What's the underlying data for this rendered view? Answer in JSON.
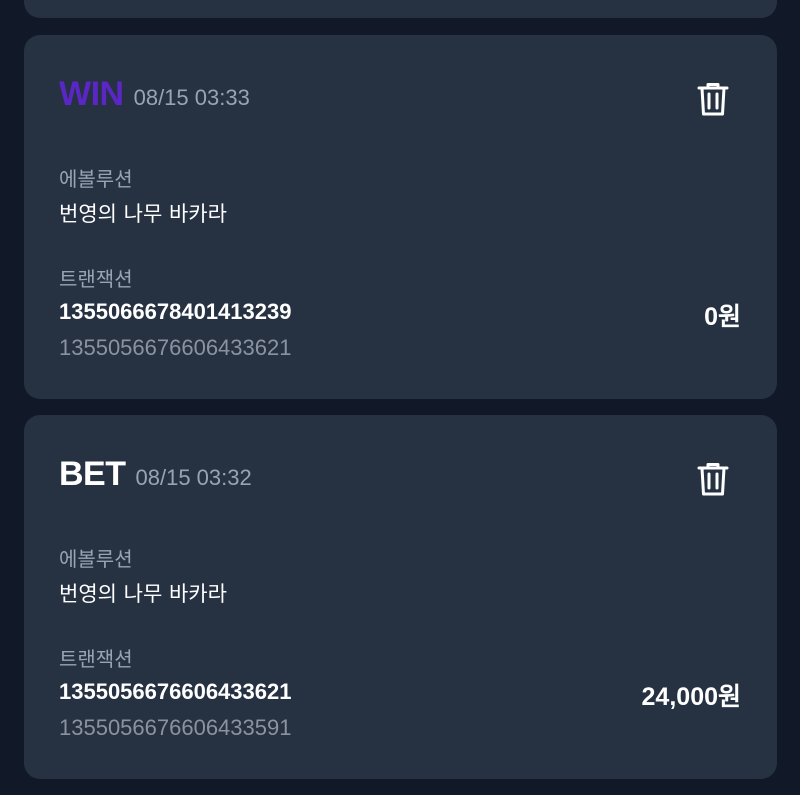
{
  "colors": {
    "background": "#111827",
    "card": "#263142",
    "win": "#5b26c6",
    "bet": "#ffffff",
    "muted": "#9aa3b2"
  },
  "transactions": [
    {
      "type": "WIN",
      "type_color": "#5b26c6",
      "time": "08/15 03:33",
      "provider_label": "에볼루션",
      "game_name": "번영의 나무 바카라",
      "transaction_label": "트랜잭션",
      "transaction_id": "1355066678401413239",
      "reference_id": "1355056676606433621",
      "amount": "0원",
      "delete_icon": "trash-icon"
    },
    {
      "type": "BET",
      "type_color": "#ffffff",
      "time": "08/15 03:32",
      "provider_label": "에볼루션",
      "game_name": "번영의 나무 바카라",
      "transaction_label": "트랜잭션",
      "transaction_id": "1355056676606433621",
      "reference_id": "1355056676606433591",
      "amount": "24,000원",
      "delete_icon": "trash-icon"
    }
  ]
}
